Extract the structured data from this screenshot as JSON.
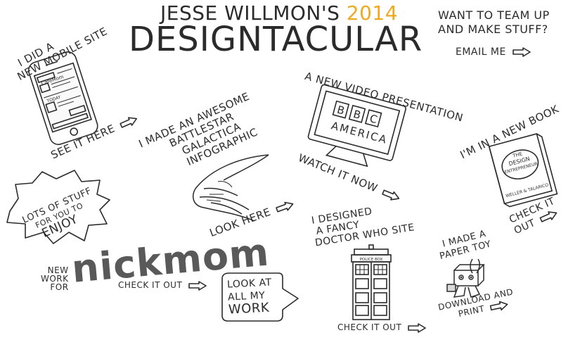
{
  "header": {
    "title_line1": "Jesse Willmon's",
    "year": "2014",
    "title_line2": "DESIGNTACULAR",
    "cta_line1": "WANT TO TEAM UP",
    "cta_line2": "AND MAKE STUFF?",
    "email_label": "EMAIL ME"
  },
  "items": {
    "mobile": {
      "headline_1": "I DID A",
      "headline_2": "NEW MOBILE SITE",
      "link": "SEE IT HERE",
      "phone_brand": "CafeMom",
      "phone_today": "TODAY"
    },
    "infographic": {
      "headline_1": "I MADE AN AWESOME",
      "headline_2": "BATTLESTAR",
      "headline_3": "GALACTICA",
      "headline_4": "INFOGRAPHIC",
      "link": "LOOK HERE"
    },
    "video": {
      "headline": "A NEW VIDEO PRESENTATION",
      "logo_letters": [
        "B",
        "B",
        "C"
      ],
      "logo_sub": "AMERICA",
      "link": "WATCH IT NOW"
    },
    "book": {
      "headline": "I'M IN A NEW BOOK",
      "cover_1": "THE",
      "cover_2": "DESIGN",
      "cover_3": "ENTREPRENEUR",
      "cover_authors": "WELLER & TALARICO",
      "link": "CHECK IT OUT"
    },
    "stuff": {
      "line1": "LOTS OF STUFF",
      "line2": "FOR YOU TO",
      "line3": "ENJOY"
    },
    "nickmom": {
      "pre_1": "NEW",
      "pre_2": "WORK",
      "pre_3": "FOR",
      "logo": "nickmom",
      "link": "CHECK IT OUT"
    },
    "work": {
      "line1": "LOOK AT",
      "line2": "ALL MY",
      "line3": "WORK"
    },
    "doctor": {
      "headline_1": "I DESIGNED",
      "headline_2": "A FANCY",
      "headline_3": "DOCTOR WHO SITE",
      "police_box": "POLICE BOX",
      "link": "CHECK IT OUT"
    },
    "toy": {
      "headline_1": "I MADE A",
      "headline_2": "PAPER TOY",
      "link_1": "DOWNLOAD AND",
      "link_2": "PRINT"
    }
  }
}
